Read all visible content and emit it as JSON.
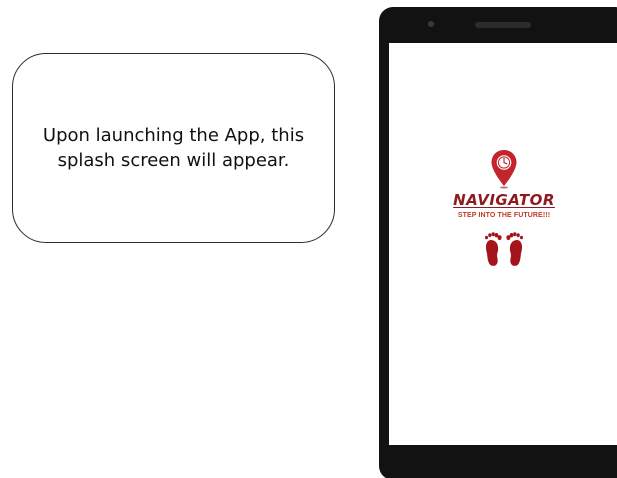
{
  "callout": {
    "text": "Upon launching the App, this splash screen will appear."
  },
  "splash": {
    "app_name": "NAVIGATOR",
    "tagline": "STEP INTO THE FUTURE!!!",
    "logo_icon": "location-pin-clock-icon",
    "footprint_icon": "footprints-icon",
    "colors": {
      "brand": "#8e1b20",
      "tagline": "#c0392b",
      "screen_background": "#ffffff",
      "device_frame": "#121212"
    }
  }
}
